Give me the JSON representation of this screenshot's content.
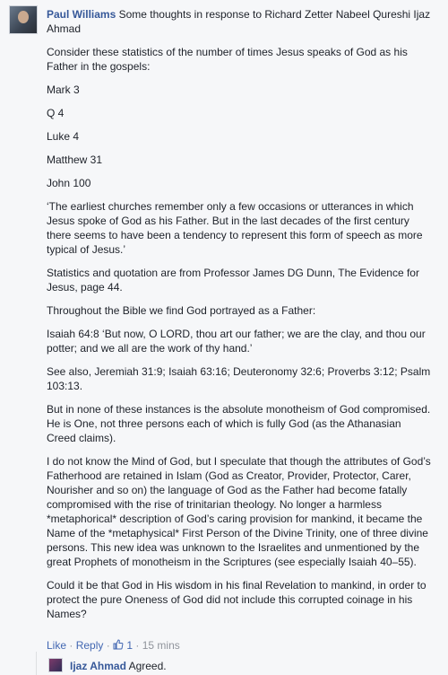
{
  "comment": {
    "author": "Paul Williams",
    "intro": "Some thoughts in response to Richard Zetter Nabeel Qureshi Ijaz Ahmad",
    "paragraphs": [
      "Consider these statistics of the number of times Jesus speaks of God as his Father in the gospels:",
      "Mark 3",
      "Q 4",
      "Luke 4",
      "Matthew 31",
      "John 100",
      "‘The earliest churches remember only a few occasions or utterances in which Jesus spoke of God as his Father. But in the last decades of the first century there seems to have been a tendency to represent this form of speech as more typical of Jesus.’",
      "Statistics and quotation are from Professor James DG Dunn, The Evidence for Jesus, page 44.",
      "Throughout the Bible we find God portrayed as a Father:",
      "Isaiah 64:8 ‘But now, O LORD, thou art our father; we are the clay, and thou our potter; and we all are the work of thy hand.’",
      "See also, Jeremiah 31:9; Isaiah 63:16; Deuteronomy 32:6; Proverbs 3:12; Psalm 103:13.",
      "But in none of these instances is the absolute monotheism of God compromised. He is One, not three persons each of which is fully God (as the Athanasian Creed claims).",
      "I do not know the Mind of God, but I speculate that though the attributes of God’s Fatherhood are retained in Islam (God as Creator, Provider, Protector, Carer, Nourisher and so on) the language of God as the Father had become fatally compromised with the rise of trinitarian theology. No longer a harmless *metaphorical* description of God’s caring provision for mankind, it became the Name of the *metaphysical* First Person of the Divine Trinity, one of three divine persons. This new idea was unknown to the Israelites and unmentioned by the great Prophets of monotheism in the Scriptures (see especially Isaiah 40–55).",
      "Could it be that God in His wisdom in his final Revelation to mankind, in order to protect the pure Oneness of God did not include this corrupted coinage in his Names?"
    ],
    "actions": {
      "like": "Like",
      "sep": " · ",
      "reply": "Reply",
      "like_count": "1",
      "time": "15 mins"
    }
  },
  "reply": {
    "author": "Ijaz Ahmad",
    "text": "Agreed."
  }
}
